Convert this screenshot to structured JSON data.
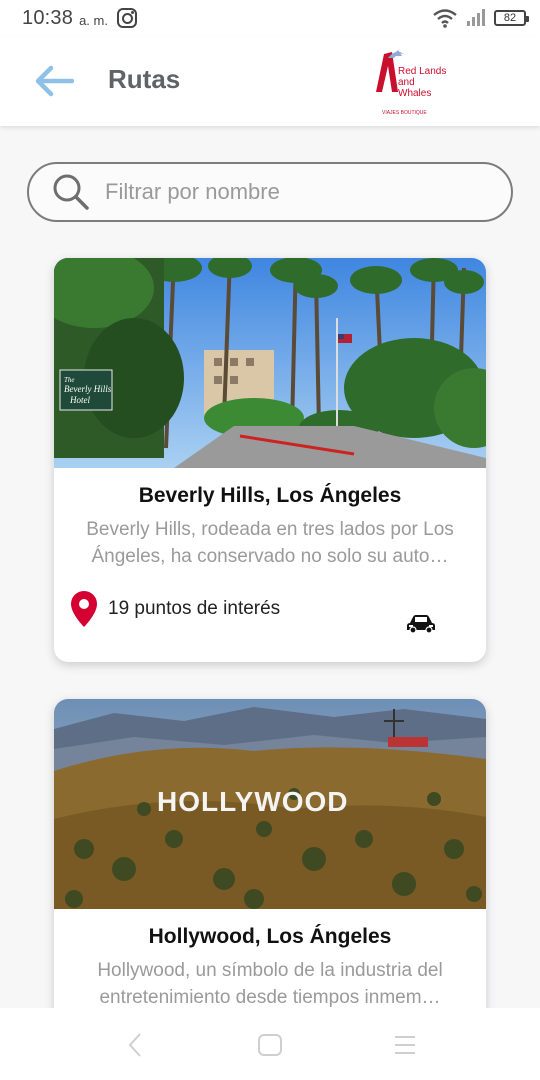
{
  "status_bar": {
    "time": "10:38",
    "ampm": "a. m.",
    "battery_level": "82",
    "icons": [
      "instagram-icon",
      "wifi-icon",
      "signal-icon",
      "battery-icon"
    ]
  },
  "header": {
    "title": "Rutas",
    "back_icon": "arrow-left-icon",
    "logo_text_line1": "Red Lands and",
    "logo_text_line2": "Whales",
    "logo_tagline": "VIAJES BOUTIQUE"
  },
  "search": {
    "placeholder": "Filtrar por nombre",
    "value": ""
  },
  "routes": [
    {
      "title": "Beverly Hills, Los Ángeles",
      "description": "Beverly Hills, rodeada en tres lados por Los Ángeles, ha conservado no solo su auto…",
      "poi_count_text": "19 puntos de interés",
      "transport_icon": "car-icon",
      "sign_text_1": "The",
      "sign_text_2": "Beverly Hills",
      "sign_text_3": "Hotel"
    },
    {
      "title": "Hollywood, Los Ángeles",
      "description": "Hollywood, un símbolo de la industria del entretenimiento desde tiempos inmem…",
      "sign_text": "HOLLYWOOD"
    }
  ],
  "colors": {
    "accent": "#8fc1e8",
    "pin": "#d50032",
    "title_gray": "#5f6368",
    "desc_gray": "#9a9a9a",
    "brand_red": "#c8102e"
  }
}
